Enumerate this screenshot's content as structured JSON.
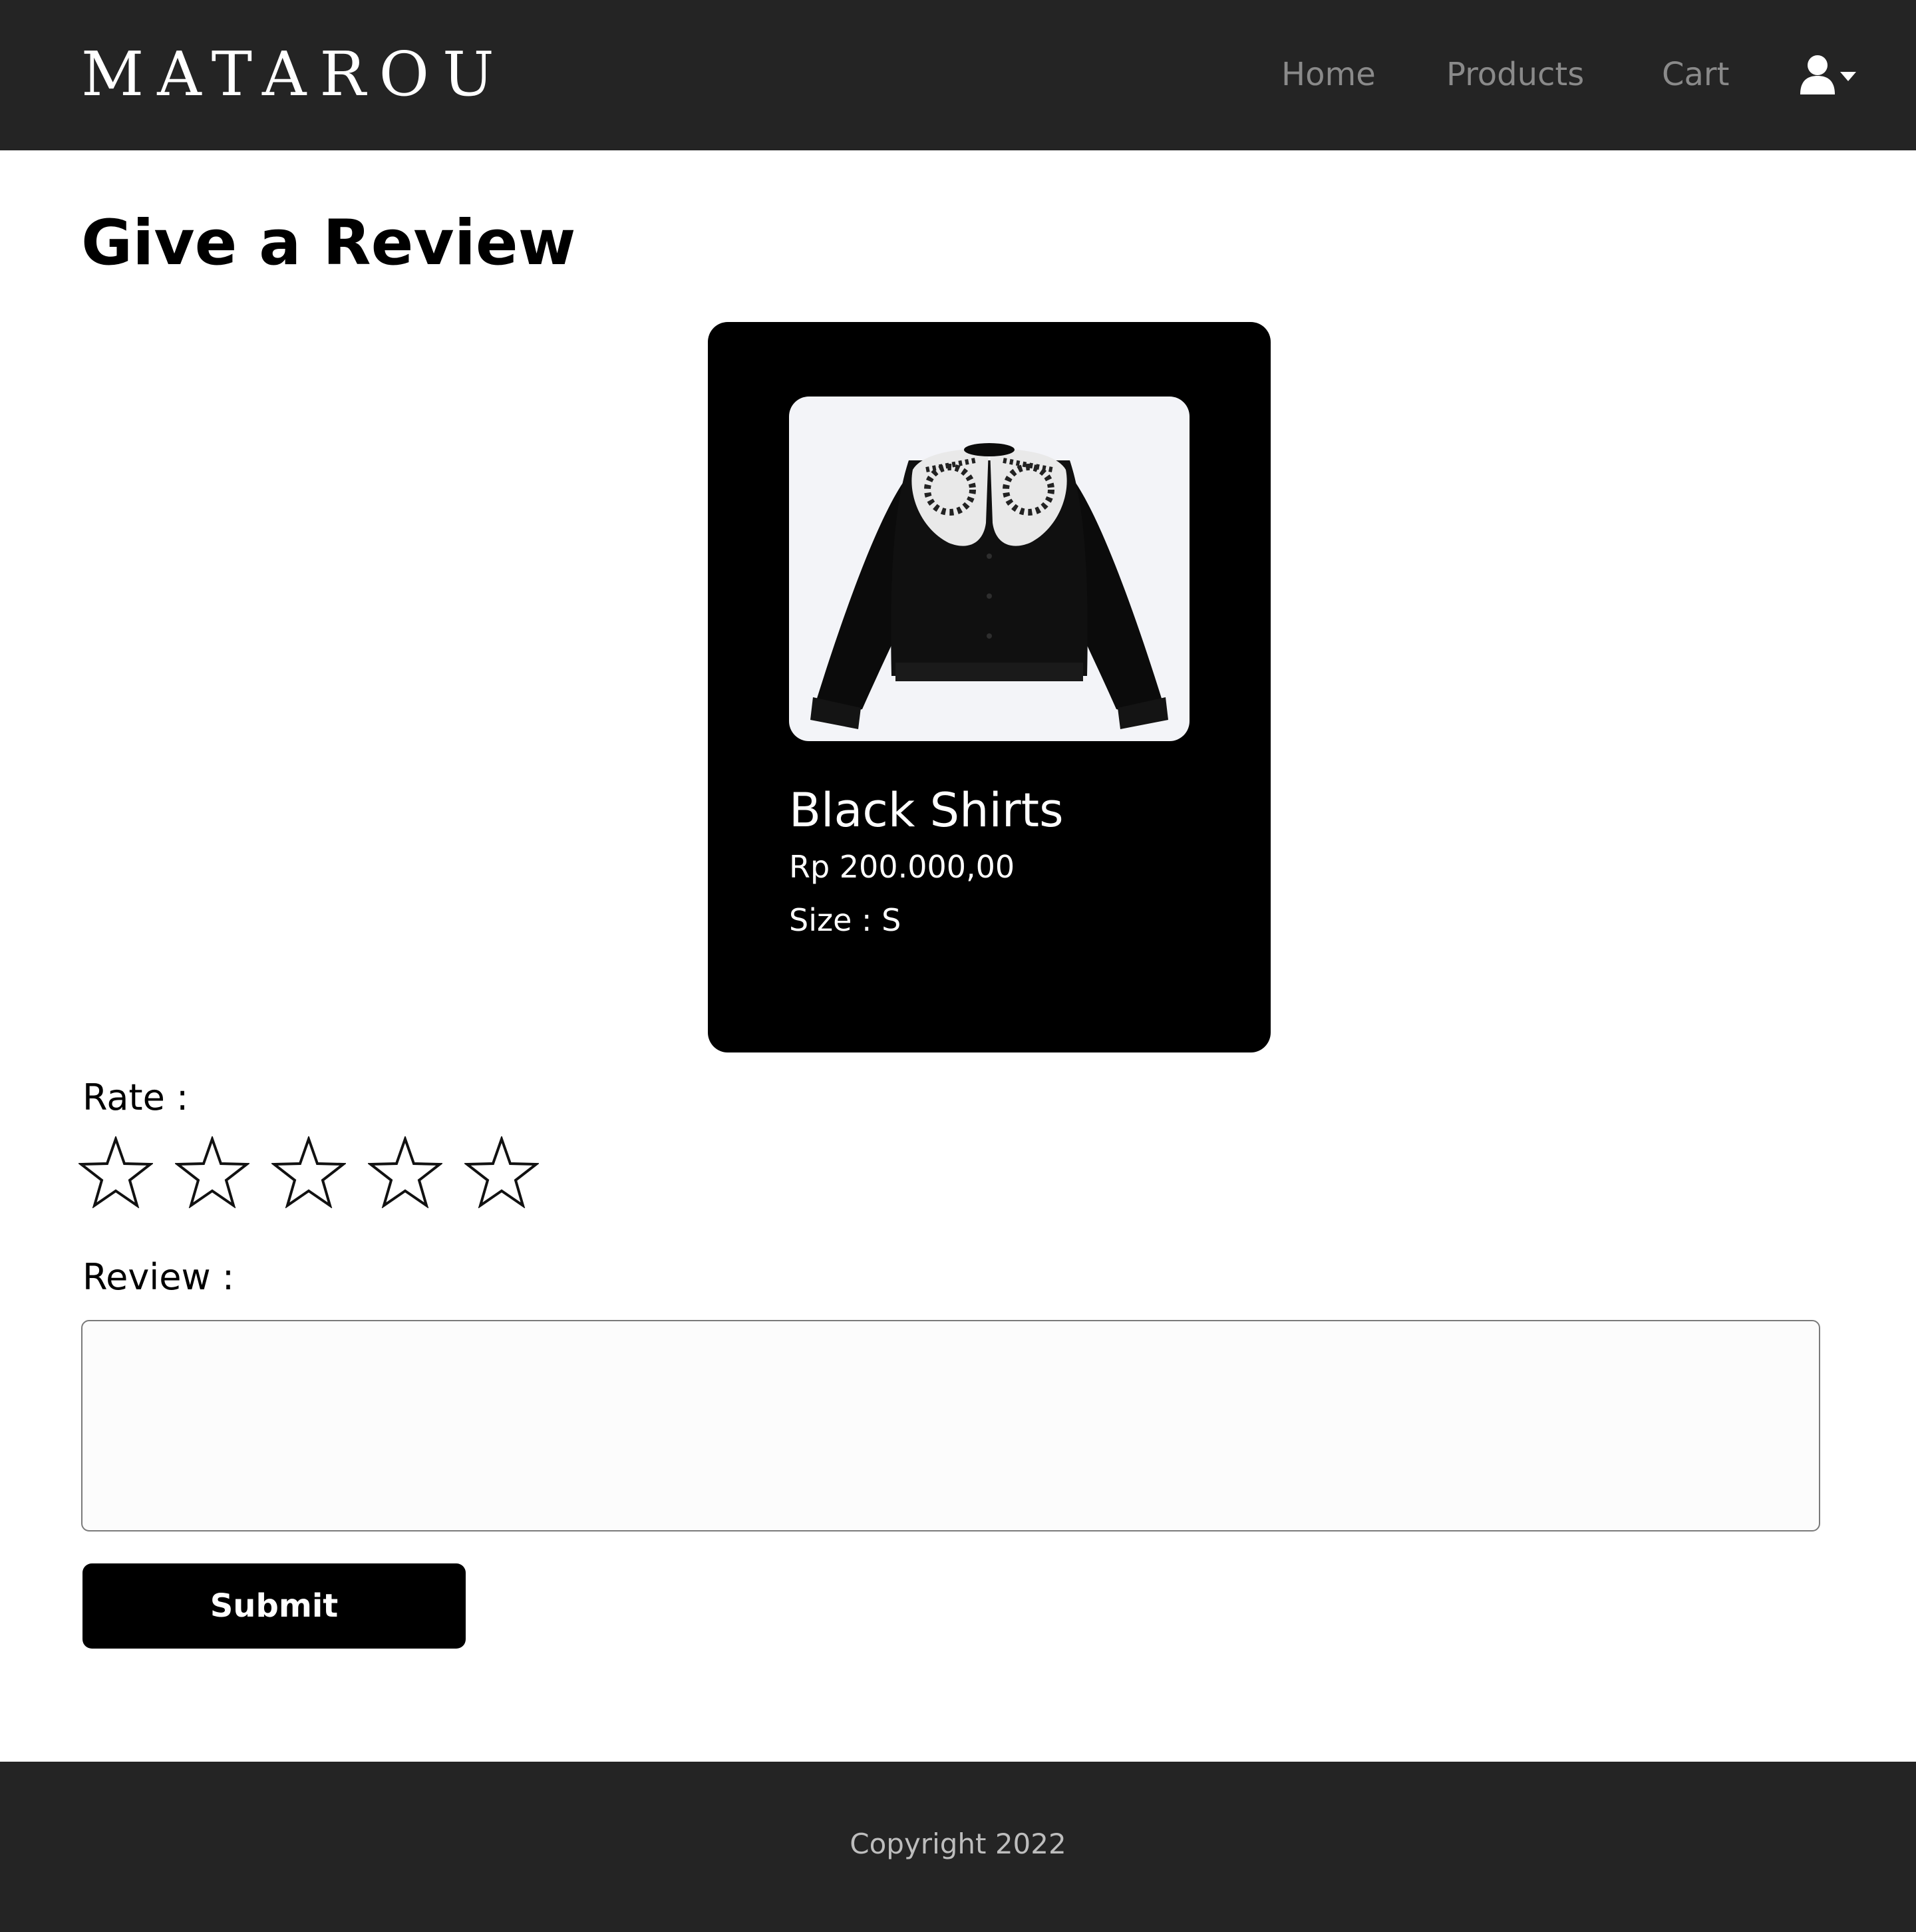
{
  "header": {
    "brand": "MATAROU",
    "nav": {
      "home": "Home",
      "products": "Products",
      "cart": "Cart"
    },
    "user_menu_icon": "user-icon",
    "dropdown_icon": "caret-down-icon"
  },
  "main": {
    "title": "Give a Review",
    "product": {
      "name": "Black Shirts",
      "price": "Rp 200.000,00",
      "size": "Size : S",
      "image_icon": "black-blouse-with-lace-collar"
    },
    "rating": {
      "label": "Rate :",
      "max_stars": 5,
      "selected_stars": 0
    },
    "review": {
      "label": "Review :",
      "value": "",
      "placeholder": ""
    },
    "submit_label": "Submit"
  },
  "footer": {
    "copyright": "Copyright 2022"
  },
  "colors": {
    "navbar_bg": "#242424",
    "card_bg": "#000000",
    "nav_link": "#8a8a8a",
    "footer_text": "#bdbdbd"
  }
}
